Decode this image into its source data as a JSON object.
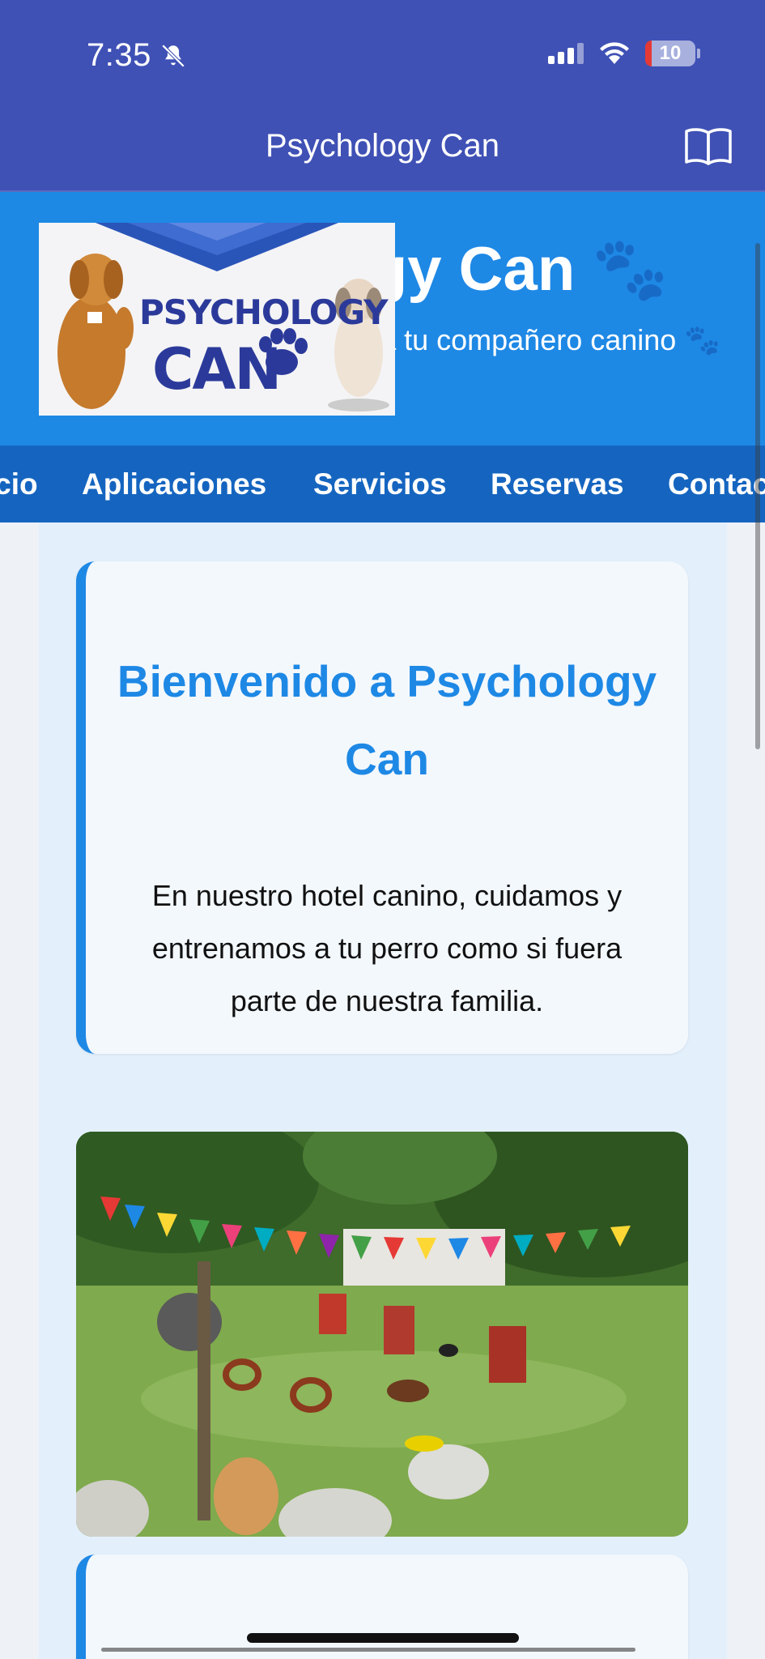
{
  "status_bar": {
    "time": "7:35",
    "battery": "10",
    "icons": [
      "bell-slash-icon",
      "cellular-signal-icon",
      "wifi-icon",
      "battery-icon"
    ]
  },
  "app_bar": {
    "title": "Psychology Can",
    "action_icon": "book-icon"
  },
  "hero": {
    "title": "Psychology Can 🐾",
    "subtitle": "Hotel y entrenamiento para tu compañero canino 🐾",
    "logo_line1": "PSYCHOLOGY",
    "logo_line2": "CAN"
  },
  "nav": {
    "items": [
      "Inicio",
      "Aplicaciones",
      "Servicios",
      "Reservas",
      "Contacto"
    ]
  },
  "welcome_card": {
    "title": "Bienvenido a Psychology Can",
    "text": "En nuestro hotel canino, cuidamos y entrenamos a tu perro como si fuera parte de nuestra familia."
  },
  "colors": {
    "app_bar": "#3f51b5",
    "hero": "#1e88e5",
    "nav": "#1565c0",
    "accent": "#1e88e5",
    "content_bg": "#e3f0fc"
  }
}
